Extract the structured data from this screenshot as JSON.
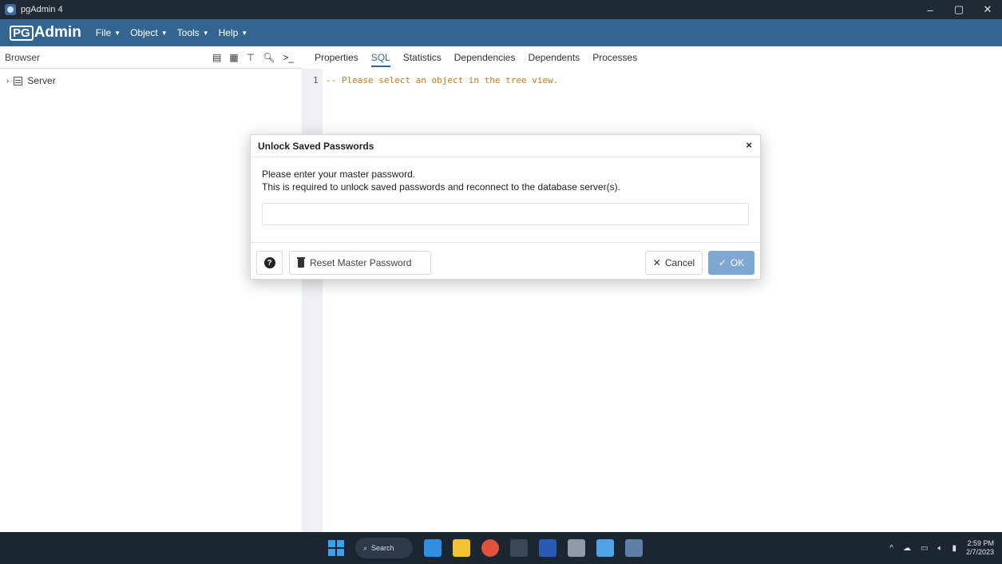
{
  "window": {
    "title": "pgAdmin 4",
    "controls": {
      "minimize": "–",
      "maximize": "▢",
      "close": "✕"
    }
  },
  "menubar": {
    "logo_pg": "PG",
    "logo_admin": "Admin",
    "items": [
      {
        "label": "File"
      },
      {
        "label": "Object"
      },
      {
        "label": "Tools"
      },
      {
        "label": "Help"
      }
    ]
  },
  "browser": {
    "label": "Browser",
    "tools": [
      "object-properties-icon",
      "view-data-icon",
      "filter-rows-icon",
      "search-icon",
      "psql-tool-icon"
    ],
    "tree": [
      {
        "label": "Server"
      }
    ]
  },
  "tabs": [
    {
      "label": "Properties",
      "active": false
    },
    {
      "label": "SQL",
      "active": true
    },
    {
      "label": "Statistics",
      "active": false
    },
    {
      "label": "Dependencies",
      "active": false
    },
    {
      "label": "Dependents",
      "active": false
    },
    {
      "label": "Processes",
      "active": false
    }
  ],
  "editor": {
    "line_number": "1",
    "code": "-- Please select an object in the tree view."
  },
  "dialog": {
    "title": "Unlock Saved Passwords",
    "close": "×",
    "line1": "Please enter your master password.",
    "line2": "This is required to unlock saved passwords and reconnect to the database server(s).",
    "password_value": "",
    "help_icon": "?",
    "reset_label": "Reset Master Password",
    "cancel_label": "Cancel",
    "ok_label": "OK"
  },
  "taskbar": {
    "search_label": "Search",
    "apps": [
      "vscode",
      "file-explorer",
      "chrome",
      "terminal",
      "word",
      "settings",
      "notepad",
      "pgadmin"
    ],
    "time": "2:59 PM",
    "date": "2/7/2023"
  },
  "colors": {
    "menubar": "#326690",
    "titlebar": "#1f2a36",
    "ok_button": "#7ea7d1",
    "sql_comment": "#c67a20"
  }
}
